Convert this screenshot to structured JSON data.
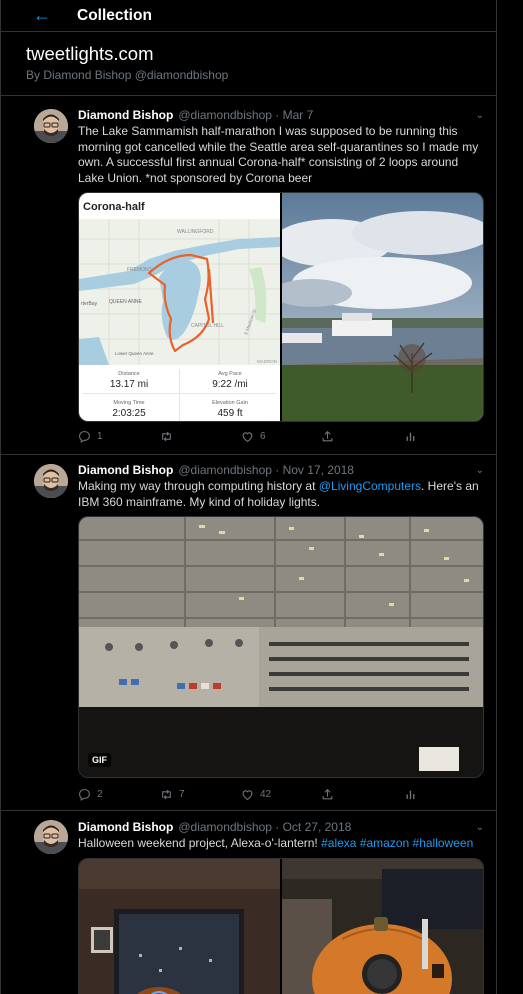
{
  "header": {
    "title": "Collection"
  },
  "collection": {
    "title": "tweetlights.com",
    "byline": "By Diamond Bishop @diamondbishop"
  },
  "tweets": [
    {
      "name": "Diamond Bishop",
      "handle": "@diamondbishop",
      "date": "Mar 7",
      "text": "The Lake Sammamish half-marathon I was supposed to be running this morning got cancelled while the Seattle area self-quarantines so I made my own. A successful first annual Corona-half* consisting of 2 loops around Lake Union. *not sponsored by Corona beer",
      "map": {
        "title": "Corona-half",
        "labels": [
          "WALLINGFORD",
          "FREMONT",
          "QUEEN ANNE",
          "rterBay",
          "CAPITOL HILL",
          "Lower Queen Anne",
          "E Madison St",
          "MADRON"
        ],
        "stats": [
          {
            "label": "Distance",
            "value": "13.17 mi"
          },
          {
            "label": "Avg Pace",
            "value": "9:22 /mi"
          },
          {
            "label": "Moving Time",
            "value": "2:03:25"
          },
          {
            "label": "Elevation Gain",
            "value": "459 ft"
          }
        ]
      },
      "replies": "1",
      "retweets": "",
      "likes": "6"
    },
    {
      "name": "Diamond Bishop",
      "handle": "@diamondbishop",
      "date": "Nov 17, 2018",
      "text_before": "Making my way through computing history at ",
      "mention": "@LivingComputers",
      "text_after": ". Here's an IBM 360 mainframe. My kind of holiday lights.",
      "badge": "GIF",
      "replies": "2",
      "retweets": "7",
      "likes": "42"
    },
    {
      "name": "Diamond Bishop",
      "handle": "@diamondbishop",
      "date": "Oct 27, 2018",
      "text": "Halloween weekend project, Alexa-o'-lantern! ",
      "hashtags": [
        "#alexa",
        "#amazon",
        "#halloween"
      ]
    }
  ],
  "colors": {
    "accent": "#1d9bf0",
    "border": "#2f3336",
    "secondary": "#6e767d",
    "background": "#000000"
  },
  "icons": [
    "back-arrow-icon",
    "chevron-down-icon",
    "reply-icon",
    "retweet-icon",
    "like-icon",
    "share-icon",
    "analytics-icon"
  ]
}
